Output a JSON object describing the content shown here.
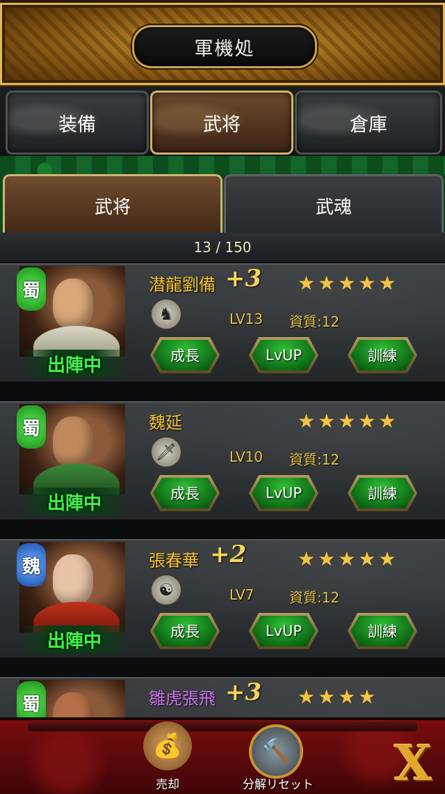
{
  "header": {
    "title": "軍機処"
  },
  "tabs": [
    {
      "label": "装備",
      "active": false
    },
    {
      "label": "武将",
      "active": true
    },
    {
      "label": "倉庫",
      "active": false
    }
  ],
  "subtabs": [
    {
      "label": "武将",
      "active": true
    },
    {
      "label": "武魂",
      "active": false
    }
  ],
  "count": "13 / 150",
  "generals": [
    {
      "name": "潜龍劉備",
      "plus": "+3",
      "stars": "★★★★★",
      "kingdom": "蜀",
      "type_icon": "horse-icon",
      "level": "LV13",
      "quality": "資質:12",
      "status": "出陣中",
      "buttons": [
        "成長",
        "LvUP",
        "訓練"
      ]
    },
    {
      "name": "魏延",
      "plus": "",
      "stars": "★★★★★",
      "kingdom": "蜀",
      "type_icon": "sword-icon",
      "level": "LV10",
      "quality": "資質:12",
      "status": "出陣中",
      "buttons": [
        "成長",
        "LvUP",
        "訓練"
      ]
    },
    {
      "name": "張春華",
      "plus": "+2",
      "stars": "★★★★★",
      "kingdom": "魏",
      "type_icon": "yin-yang-icon",
      "level": "LV7",
      "quality": "資質:12",
      "status": "出陣中",
      "buttons": [
        "成長",
        "LvUP",
        "訓練"
      ]
    },
    {
      "name": "雛虎張飛",
      "plus": "+3",
      "stars": "★★★★",
      "kingdom": "蜀"
    }
  ],
  "bottom": {
    "sell_label": "売却",
    "reset_label": "分解リセット"
  },
  "colors": {
    "gold": "#f5c231",
    "green": "#3ef24a",
    "purple": "#cf72f0",
    "shu": "#1b8f1a",
    "wei": "#1a4fae"
  }
}
